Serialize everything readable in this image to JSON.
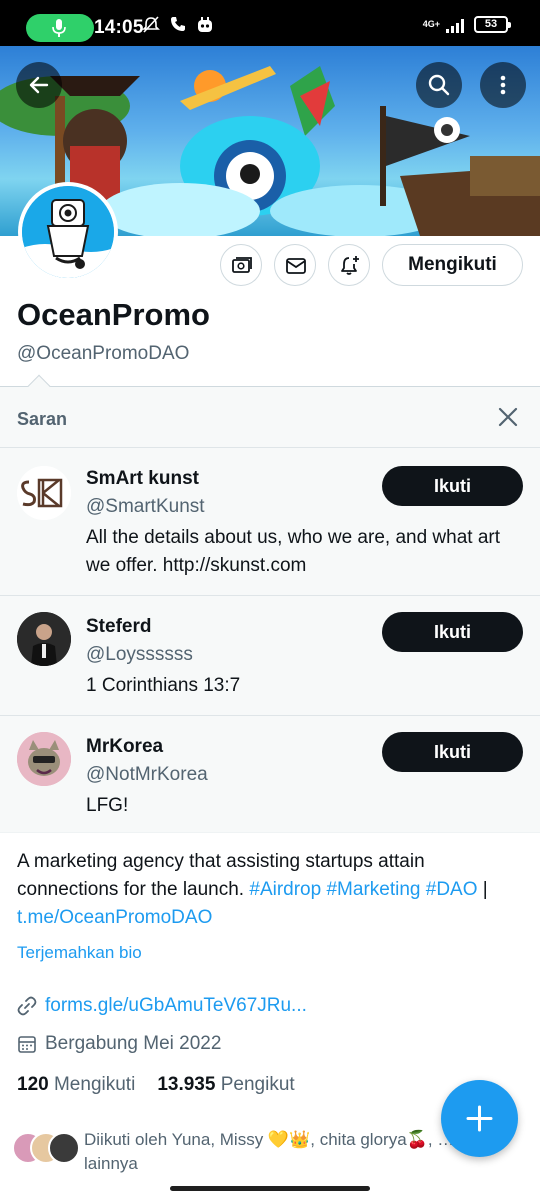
{
  "status_bar": {
    "time": "14:05",
    "network": "4G+",
    "battery": "53"
  },
  "profile": {
    "name": "OceanPromo",
    "handle": "@OceanPromoDAO",
    "follow_state_label": "Mengikuti",
    "bio_text": "A marketing agency that assisting startups attain connections for the launch.",
    "bio_tags": [
      "#Airdrop",
      "#Marketing",
      "#DAO"
    ],
    "bio_separator": "|",
    "bio_link": "t.me/OceanPromoDAO",
    "translate_label": "Terjemahkan bio",
    "website": "forms.gle/uGbAmuTeV67JRu...",
    "joined": "Bergabung Mei 2022",
    "following_count": "120",
    "following_label": "Mengikuti",
    "followers_count": "13.935",
    "followers_label": "Pengikut",
    "followed_by_line1": "Diikuti oleh Yuna, Missy 💛👑, chita glorya🍒, …",
    "followed_by_line2": "lainnya"
  },
  "suggestions": {
    "title": "Saran",
    "items": [
      {
        "name": "SmArt kunst",
        "handle": "@SmartKunst",
        "bio": "All the details about us, who we are, and what art we offer.  http://skunst.com",
        "button": "Ikuti"
      },
      {
        "name": "Steferd",
        "handle": "@Loyssssss",
        "bio": "1 Corinthians 13:7",
        "button": "Ikuti"
      },
      {
        "name": "MrKorea",
        "handle": "@NotMrKorea",
        "bio": "LFG!",
        "button": "Ikuti"
      }
    ]
  },
  "colors": {
    "accent": "#1d9bf0",
    "text_primary": "#0f1419",
    "text_secondary": "#536471",
    "follow_button": "#0f1419",
    "mic_indicator": "#2fd06a"
  },
  "icons": {
    "back": "arrow-left-icon",
    "search": "search-icon",
    "more": "more-vertical-icon",
    "monetize": "money-icon",
    "message": "mail-icon",
    "notify": "bell-plus-icon",
    "close": "close-icon",
    "link": "link-icon",
    "calendar": "calendar-icon",
    "compose": "plus-icon"
  }
}
